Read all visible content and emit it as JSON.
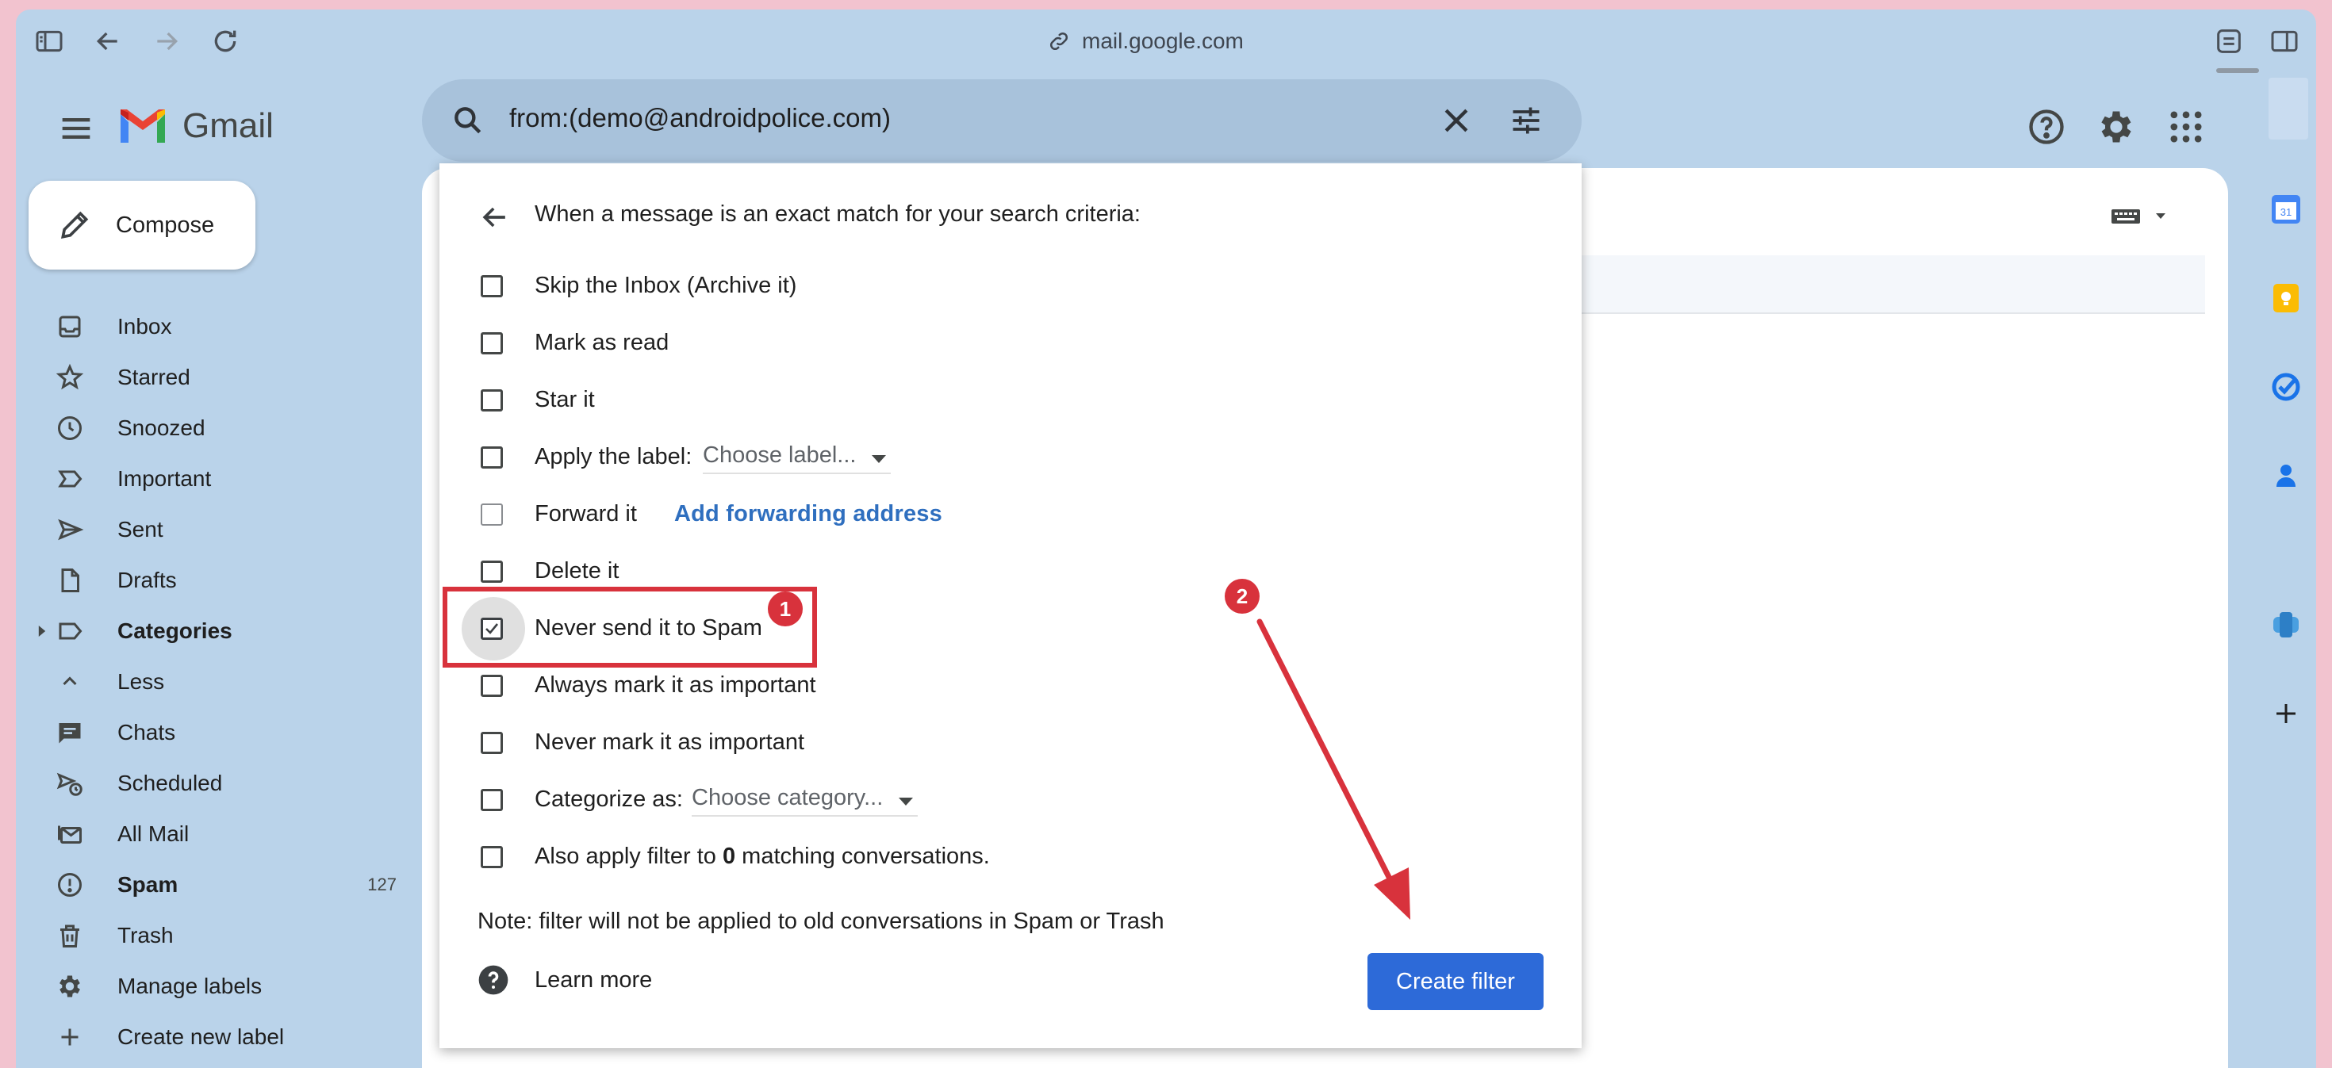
{
  "browser": {
    "url": "mail.google.com",
    "icons": [
      "sidebar-toggle-icon",
      "back-arrow-icon",
      "forward-arrow-icon",
      "reload-icon",
      "link-icon",
      "extension-icon",
      "split-view-icon"
    ]
  },
  "app": {
    "name": "Gmail",
    "search_query": "from:(demo@androidpolice.com)"
  },
  "compose_label": "Compose",
  "nav": [
    {
      "label": "Inbox",
      "icon": "inbox-icon"
    },
    {
      "label": "Starred",
      "icon": "star-icon"
    },
    {
      "label": "Snoozed",
      "icon": "clock-icon"
    },
    {
      "label": "Important",
      "icon": "label-important-icon"
    },
    {
      "label": "Sent",
      "icon": "send-icon"
    },
    {
      "label": "Drafts",
      "icon": "draft-icon"
    },
    {
      "label": "Categories",
      "icon": "label-icon",
      "bold": true
    },
    {
      "label": "Less",
      "icon": "chevron-up-icon"
    },
    {
      "label": "Chats",
      "icon": "chat-icon"
    },
    {
      "label": "Scheduled",
      "icon": "schedule-send-icon"
    },
    {
      "label": "All Mail",
      "icon": "all-mail-icon"
    },
    {
      "label": "Spam",
      "icon": "spam-icon",
      "bold": true,
      "count": "127"
    },
    {
      "label": "Trash",
      "icon": "trash-icon"
    },
    {
      "label": "Manage labels",
      "icon": "gear-icon"
    },
    {
      "label": "Create new label",
      "icon": "plus-icon"
    }
  ],
  "filter_dialog": {
    "title": "When a message is an exact match for your search criteria:",
    "options": {
      "skip_inbox": "Skip the Inbox (Archive it)",
      "mark_read": "Mark as read",
      "star": "Star it",
      "apply_label": "Apply the label:",
      "label_placeholder": "Choose label...",
      "forward": "Forward it",
      "forward_link": "Add forwarding address",
      "delete": "Delete it",
      "never_spam": "Never send it to Spam",
      "always_important": "Always mark it as important",
      "never_important": "Never mark it as important",
      "categorize": "Categorize as:",
      "category_placeholder": "Choose category...",
      "also_apply_pre": "Also apply filter to",
      "also_apply_count": "0",
      "also_apply_post": "matching conversations."
    },
    "never_spam_checked": true,
    "note": "Note: filter will not be applied to old conversations in Spam or Trash",
    "learn_more": "Learn more",
    "create_button": "Create filter"
  },
  "annotations": {
    "badge_1": "1",
    "badge_2": "2",
    "color": "#d8323c"
  },
  "colors": {
    "background": "#bad3ea",
    "primary_button": "#2d6ad8",
    "link": "#2f6fbf"
  }
}
